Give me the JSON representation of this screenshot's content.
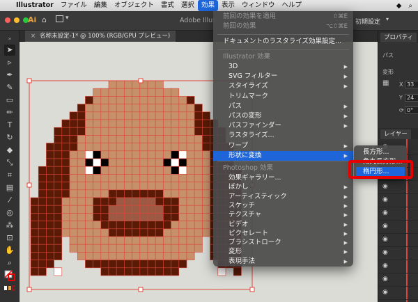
{
  "menubar": {
    "app": "Illustrator",
    "items": [
      "ファイル",
      "編集",
      "オブジェクト",
      "書式",
      "選択",
      "効果",
      "表示",
      "ウィンドウ",
      "ヘルプ"
    ],
    "active": "効果"
  },
  "toolbar": {
    "doc_title": "Adobe Illus",
    "workspace": "初期設定"
  },
  "document_tab": {
    "label": "名称未設定-1* @ 100% (RGB/GPU プレビュー)"
  },
  "effect_menu": {
    "apply_last": {
      "label": "前回の効果を適用",
      "shortcut": "⇧⌘E"
    },
    "last_effect": {
      "label": "前回の効果",
      "shortcut": "⌥⇧⌘E"
    },
    "raster_settings": "ドキュメントのラスタライズ効果設定...",
    "illustrator_header": "Illustrator 効果",
    "illustrator_items": [
      "3D",
      "SVG フィルター",
      "スタイライズ",
      "トリムマーク",
      "パス",
      "パスの変形",
      "パスファインダー",
      "ラスタライズ...",
      "ワープ",
      "形状に変換"
    ],
    "photoshop_header": "Photoshop 効果",
    "photoshop_items": [
      "効果ギャラリー...",
      "ぼかし",
      "アーティスティック",
      "スケッチ",
      "テクスチャ",
      "ビデオ",
      "ピクセレート",
      "ブラシストローク",
      "変形",
      "表現手法"
    ]
  },
  "convert_submenu": {
    "items": [
      "長方形...",
      "角丸長方形...",
      "楕円形..."
    ],
    "highlighted": "楕円形..."
  },
  "right_panel": {
    "properties_tab": "プロパティ",
    "path_label": "パス",
    "transform_label": "変形",
    "x_label": "X",
    "x_value": "33",
    "y_label": "Y",
    "y_value": "24",
    "angle_value": "0°",
    "layers_tab": "レイヤー"
  },
  "colors": {
    "accent": "#1d65d9",
    "highlight_box": "#e60000",
    "selection": "#e0443b",
    "skin": "#c6906a",
    "dark_brown": "#5a1a06",
    "mid_brown": "#9c5a44"
  }
}
